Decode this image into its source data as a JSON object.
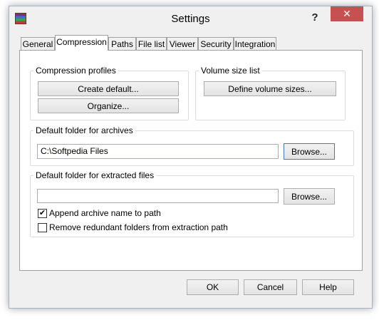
{
  "window": {
    "title": "Settings"
  },
  "titlebar": {
    "help": "?",
    "close": "✕"
  },
  "tabs": [
    {
      "label": "General"
    },
    {
      "label": "Compression"
    },
    {
      "label": "Paths"
    },
    {
      "label": "File list"
    },
    {
      "label": "Viewer"
    },
    {
      "label": "Security"
    },
    {
      "label": "Integration"
    }
  ],
  "compression_profiles": {
    "legend": "Compression profiles",
    "create_default": "Create default...",
    "organize": "Organize..."
  },
  "volume_size_list": {
    "legend": "Volume size list",
    "define": "Define volume sizes..."
  },
  "default_archive_folder": {
    "legend": "Default folder for archives",
    "value": "C:\\Softpedia Files",
    "browse": "Browse..."
  },
  "default_extract_folder": {
    "legend": "Default folder for extracted files",
    "value": "",
    "browse": "Browse...",
    "append_archive_name": {
      "label": "Append archive name to path",
      "checked": true
    },
    "remove_redundant": {
      "label": "Remove redundant folders from extraction path",
      "checked": false
    }
  },
  "footer": {
    "ok": "OK",
    "cancel": "Cancel",
    "help": "Help"
  }
}
